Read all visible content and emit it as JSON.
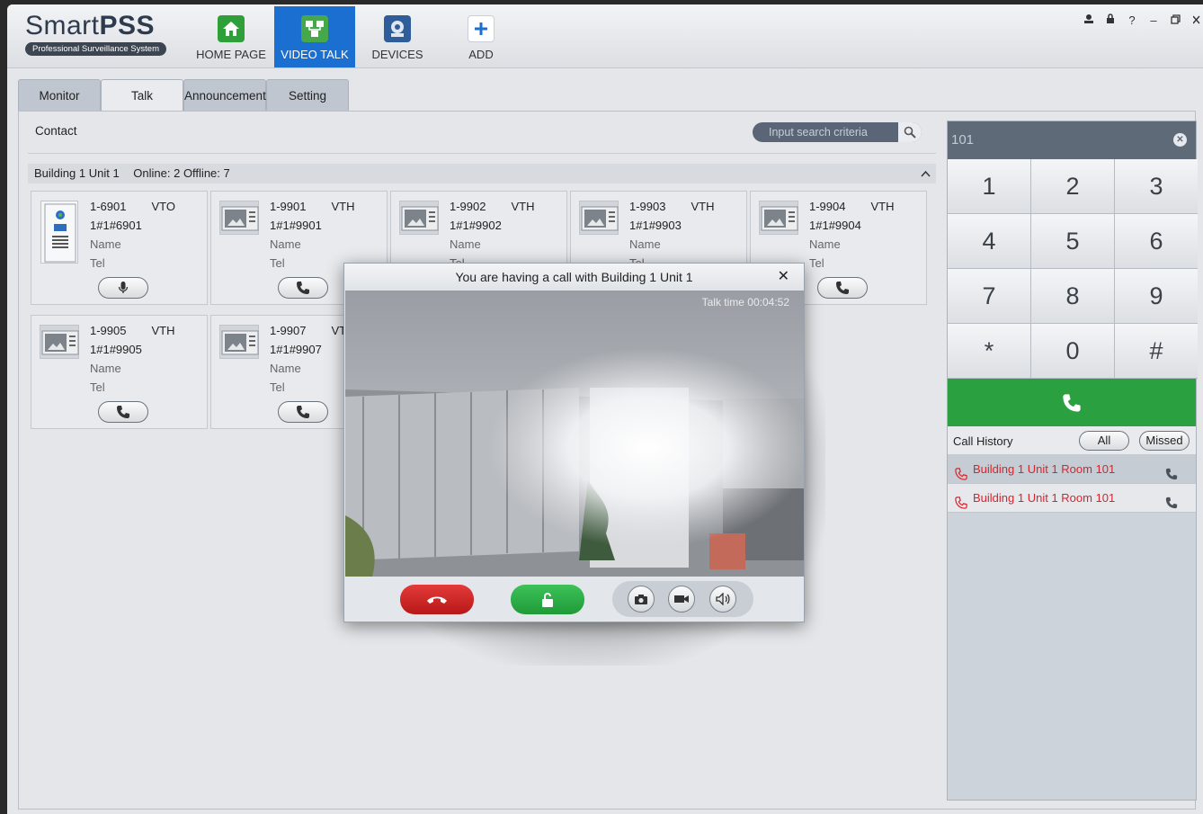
{
  "app": {
    "logo_main": "Smart",
    "logo_bold": "PSS",
    "logo_sub": "Professional Surveillance System"
  },
  "nav": {
    "home": "HOME PAGE",
    "video_talk": "VIDEO TALK",
    "devices": "DEVICES",
    "add": "ADD"
  },
  "window_controls": {
    "help": "?",
    "minimize": "–"
  },
  "tabs": [
    "Monitor",
    "Talk",
    "Announcement",
    "Setting"
  ],
  "contact": {
    "title": "Contact",
    "search_placeholder": "Input search criteria",
    "group_label": "Building 1 Unit 1",
    "group_status": "Online: 2 Offline: 7",
    "cards": [
      {
        "id": "1-6901",
        "type": "VTO",
        "code": "1#1#6901",
        "name": "Name",
        "tel": "Tel"
      },
      {
        "id": "1-9901",
        "type": "VTH",
        "code": "1#1#9901",
        "name": "Name",
        "tel": "Tel"
      },
      {
        "id": "1-9902",
        "type": "VTH",
        "code": "1#1#9902",
        "name": "Name",
        "tel": "Tel"
      },
      {
        "id": "1-9903",
        "type": "VTH",
        "code": "1#1#9903",
        "name": "Name",
        "tel": "Tel"
      },
      {
        "id": "1-9904",
        "type": "VTH",
        "code": "1#1#9904",
        "name": "Name",
        "tel": "Tel"
      },
      {
        "id": "1-9905",
        "type": "VTH",
        "code": "1#1#9905",
        "name": "Name",
        "tel": "Tel"
      },
      {
        "id": "1-9907",
        "type": "VTH",
        "code": "1#1#9907",
        "name": "Name",
        "tel": "Tel"
      }
    ]
  },
  "dialpad": {
    "display_value": "101",
    "keys": [
      "1",
      "2",
      "3",
      "4",
      "5",
      "6",
      "7",
      "8",
      "9",
      "*",
      "0",
      "#"
    ]
  },
  "call_history": {
    "title": "Call History",
    "filter_all": "All",
    "filter_missed": "Missed",
    "rows": [
      {
        "label": "Building 1 Unit 1 Room 101"
      },
      {
        "label": "Building 1 Unit 1 Room 101"
      }
    ]
  },
  "call_dialog": {
    "title": "You are having a call with Building 1 Unit 1",
    "talk_time": "Talk time 00:04:52"
  },
  "colors": {
    "accent": "#1b6fd0",
    "call_green": "#2aa040",
    "hangup_red": "#c81f1f",
    "missed_red": "#d8252c"
  }
}
